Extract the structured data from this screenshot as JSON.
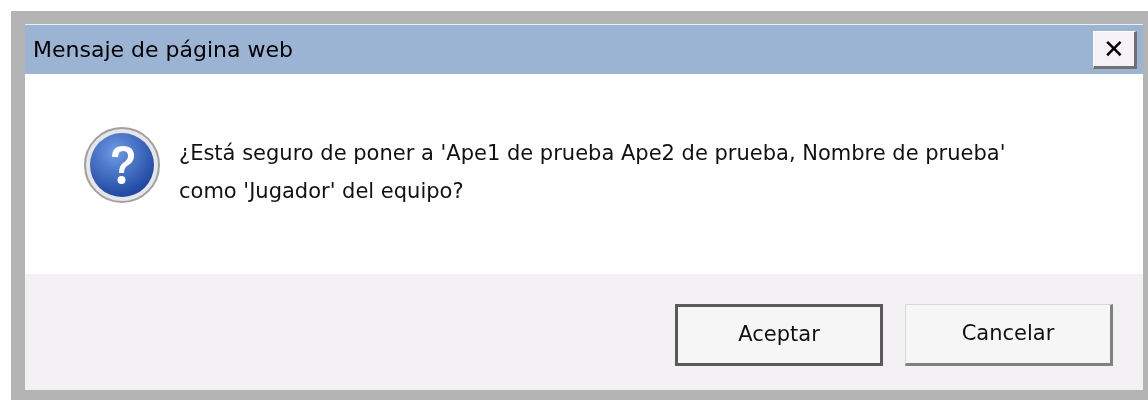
{
  "window": {
    "title": "Mensaje de página web",
    "close": "✕"
  },
  "message": "¿Está seguro de poner a 'Ape1 de prueba Ape2 de prueba, Nombre de prueba' como 'Jugador' del equipo?",
  "buttons": [
    {
      "label": "Aceptar",
      "default": true
    },
    {
      "label": "Cancelar",
      "default": false
    }
  ]
}
